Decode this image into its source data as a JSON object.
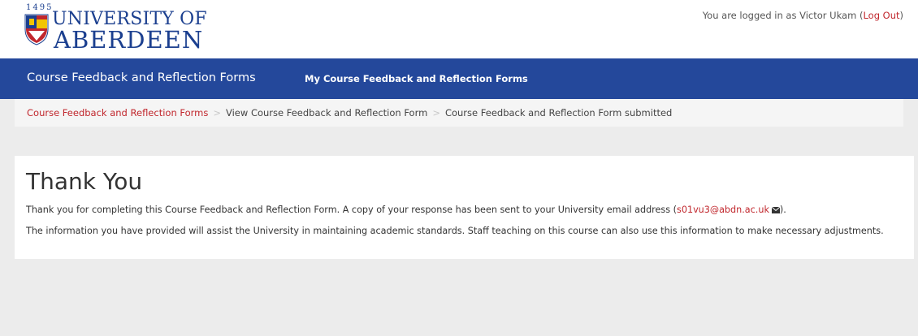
{
  "header": {
    "logo_year": "1495",
    "logo_line1": "UNIVERSITY OF",
    "logo_line2": "ABERDEEN",
    "login_prefix": "You are logged in as Victor Ukam (",
    "logout_label": "Log Out",
    "login_suffix": ")"
  },
  "nav": {
    "brand": "Course Feedback and Reflection Forms",
    "link": "My Course Feedback and Reflection Forms"
  },
  "breadcrumb": {
    "items": [
      "Course Feedback and Reflection Forms",
      "View Course Feedback and Reflection Form",
      "Course Feedback and Reflection Form submitted"
    ],
    "separator": ">"
  },
  "content": {
    "heading": "Thank You",
    "p1_before": "Thank you for completing this Course Feedback and Reflection Form. A copy of your response has been sent to your University email address (",
    "email": "s01vu3@abdn.ac.uk",
    "p1_after": ").",
    "p2": "The information you have provided will assist the University in maintaining academic standards. Staff teaching on this course can also use this information to make necessary adjustments."
  },
  "colors": {
    "nav_background": "#24489b",
    "link": "#c1272d",
    "page_background": "#ececec"
  },
  "icons": [
    "university-crest",
    "envelope-icon"
  ]
}
